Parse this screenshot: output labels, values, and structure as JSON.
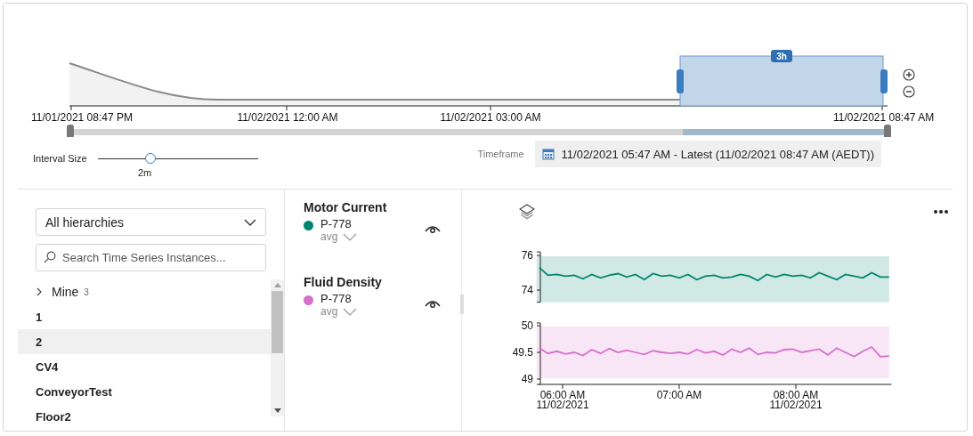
{
  "timeline": {
    "axis_labels": [
      "11/01/2021 08:47 PM",
      "11/02/2021 12:00 AM",
      "11/02/2021 03:00 AM",
      "11/02/2021 08:47 AM"
    ],
    "brush_label": "3h"
  },
  "interval": {
    "label": "Interval Size",
    "level": 0.33,
    "reading": "2m"
  },
  "timeframe": {
    "label": "Timeframe",
    "value": "11/02/2021 05:47 AM - Latest (11/02/2021 08:47 AM (AEDT))"
  },
  "hierarchy_select": {
    "value": "All hierarchies"
  },
  "search": {
    "placeholder": "Search Time Series Instances..."
  },
  "tree": [
    {
      "label": "Mine",
      "count": "3",
      "kind": "folder",
      "expanded": false,
      "selected": false
    },
    {
      "label": "1",
      "kind": "instance",
      "selected": false
    },
    {
      "label": "2",
      "kind": "instance",
      "selected": true
    },
    {
      "label": "CV4",
      "kind": "instance",
      "selected": false
    },
    {
      "label": "ConveyorTest",
      "kind": "instance",
      "selected": false
    },
    {
      "label": "Floor2",
      "kind": "instance",
      "selected": false
    }
  ],
  "legend": [
    {
      "instance": "P-778",
      "aggregate": "avg",
      "visible": true
    },
    {
      "instance": "P-778",
      "aggregate": "avg",
      "visible": true
    }
  ],
  "charts": [
    {
      "chart_data": {
        "type": "line",
        "categories": [
          null,
          null,
          null,
          null,
          null,
          null,
          null,
          null,
          null,
          null,
          null,
          null,
          null,
          null,
          null,
          null,
          null,
          null,
          null,
          null,
          null,
          null,
          null,
          null,
          null,
          null,
          null,
          null,
          null,
          null,
          null,
          null,
          null,
          null,
          null,
          null,
          null,
          null,
          null,
          null,
          null
        ],
        "series": [
          {
            "name": "Motor Current",
            "color": "#00856f",
            "values": [
              75.3,
              74.85,
              74.9,
              74.8,
              74.85,
              74.65,
              74.9,
              74.7,
              74.85,
              74.95,
              74.75,
              74.9,
              74.6,
              74.95,
              74.8,
              74.85,
              74.7,
              74.9,
              74.6,
              74.8,
              74.85,
              74.7,
              74.75,
              74.9,
              74.8,
              74.55,
              74.9,
              74.75,
              74.9,
              74.8,
              74.85,
              74.7,
              75.0,
              74.8,
              74.6,
              74.9,
              74.8,
              74.7,
              75.0,
              74.75,
              74.75
            ]
          }
        ],
        "ylim": [
          73.3,
          76.2
        ],
        "yticks": [
          {
            "value": 74,
            "label": "74"
          },
          {
            "value": 76,
            "label": "76"
          }
        ],
        "bands": [
          {
            "axis": "y",
            "from": 73.3,
            "to": 75.95
          }
        ]
      }
    },
    {
      "chart_data": {
        "type": "line",
        "x": [
          5.8,
          5.875,
          5.95,
          6.025,
          6.1,
          6.175,
          6.25,
          6.325,
          6.4,
          6.475,
          6.55,
          6.625,
          6.7,
          6.775,
          6.85,
          6.925,
          7,
          7.075,
          7.15,
          7.225,
          7.3,
          7.375,
          7.45,
          7.525,
          7.6,
          7.675,
          7.75,
          7.825,
          7.9,
          7.975,
          8.05,
          8.125,
          8.2,
          8.275,
          8.35,
          8.425,
          8.5,
          8.575,
          8.65,
          8.725,
          8.8
        ],
        "series": [
          {
            "name": "Fluid Density",
            "color": "#d66fcc",
            "values": [
              49.58,
              49.48,
              49.52,
              49.47,
              49.5,
              49.44,
              49.55,
              49.48,
              49.57,
              49.5,
              49.54,
              49.5,
              49.46,
              49.53,
              49.5,
              49.48,
              49.5,
              49.47,
              49.55,
              49.49,
              49.52,
              49.45,
              49.56,
              49.5,
              49.58,
              49.46,
              49.5,
              49.49,
              49.55,
              49.56,
              49.5,
              49.53,
              49.56,
              49.45,
              49.58,
              49.5,
              49.42,
              49.52,
              49.6,
              49.42,
              49.43
            ]
          }
        ],
        "ylim": [
          48.9,
          50.05
        ],
        "yticks": [
          {
            "value": 49,
            "label": "49"
          },
          {
            "value": 49.5,
            "label": "49.5"
          },
          {
            "value": 50,
            "label": "50"
          }
        ],
        "xlim": [
          5.8,
          8.82
        ],
        "xticks": [
          {
            "value": 6,
            "label": "06:00 AM"
          },
          {
            "value": 7,
            "label": "07:00 AM"
          },
          {
            "value": 8,
            "label": "08:00 AM"
          }
        ],
        "bands": [
          {
            "axis": "y",
            "from": 49.02,
            "to": 49.99
          }
        ]
      },
      "date_labels": [
        "11/02/2021",
        "11/02/2021"
      ]
    }
  ]
}
